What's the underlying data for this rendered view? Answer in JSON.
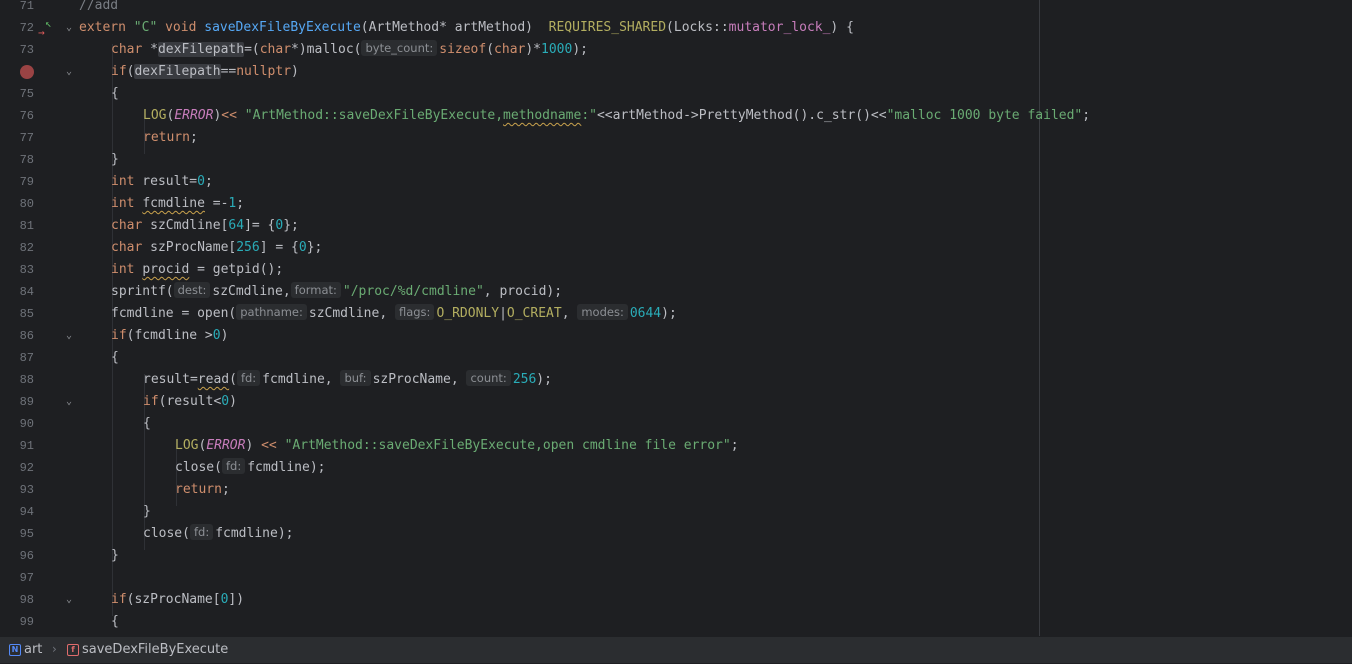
{
  "editor": {
    "line_numbers": [
      "71",
      "72",
      "73",
      "74",
      "75",
      "76",
      "77",
      "78",
      "79",
      "80",
      "81",
      "82",
      "83",
      "84",
      "85",
      "86",
      "87",
      "88",
      "89",
      "90",
      "91",
      "92",
      "93",
      "94",
      "95",
      "96",
      "97",
      "98",
      "99"
    ],
    "l71": {
      "c": "//add"
    },
    "l72": {
      "kw1": "extern",
      "str1": "\"C\"",
      "kw2": "void",
      "fn": "saveDexFileByExecute",
      "p1": "(ArtMethod* artMethod)  ",
      "mac": "REQUIRES_SHARED",
      "p2": "(Locks::",
      "tpl": "mutator_lock_",
      "p3": ") {"
    },
    "l73": {
      "kw1": "char",
      "a": " *",
      "id": "dexFilepath",
      "b": "=(",
      "kw2": "char",
      "c": "*)malloc(",
      "hint": "byte_count:",
      "kw3": "sizeof",
      "d": "(",
      "kw4": "char",
      "e": ")*",
      "num": "1000",
      "f": ");"
    },
    "l74": {
      "kw": "if",
      "a": "(",
      "id": "dexFilepath",
      "b": "==",
      "kw2": "nullptr",
      "c": ")"
    },
    "l75": {
      "a": "{"
    },
    "l76": {
      "mac": "LOG",
      "a": "(",
      "enm": "ERROR",
      "b": ")",
      "op": "<<",
      "s1": " \"ArtMethod::saveDexFileByExecute,",
      "s2": "methodname",
      "s3": ":\"",
      "c": "<<artMethod->PrettyMethod().c_str()<<",
      "s4": "\"malloc 1000 byte failed\"",
      "d": ";"
    },
    "l77": {
      "kw": "return",
      "a": ";"
    },
    "l78": {
      "a": "}"
    },
    "l79": {
      "kw": "int",
      "a": " result=",
      "num": "0",
      "b": ";"
    },
    "l80": {
      "kw": "int",
      "id": "fcmdline",
      "a": " =-",
      "num": "1",
      "b": ";"
    },
    "l81": {
      "kw": "char",
      "a": " szCmdline[",
      "num": "64",
      "b": "]= {",
      "num2": "0",
      "c": "};"
    },
    "l82": {
      "kw": "char",
      "a": " szProcName[",
      "num": "256",
      "b": "] = {",
      "num2": "0",
      "c": "};"
    },
    "l83": {
      "kw": "int",
      "id": "procid",
      "a": " = getpid();"
    },
    "l84": {
      "a": "sprintf(",
      "h1": "dest:",
      "b": "szCmdline,",
      "h2": "format:",
      "s": "\"/proc/%d/cmdline\"",
      "c": ", procid);"
    },
    "l85": {
      "a": "fcmdline = open(",
      "h1": "pathname:",
      "b": "szCmdline, ",
      "h2": "flags:",
      "m1": "O_RDONLY",
      "op": "|",
      "m2": "O_CREAT",
      "c": ", ",
      "h3": "modes:",
      "num": "0644",
      "d": ");"
    },
    "l86": {
      "kw": "if",
      "a": "(fcmdline >",
      "num": "0",
      "b": ")"
    },
    "l87": {
      "a": "{"
    },
    "l88": {
      "a": "result=",
      "id": "read",
      "b": "(",
      "h1": "fd:",
      "c": "fcmdline, ",
      "h2": "buf:",
      "d": "szProcName, ",
      "h3": "count:",
      "num": "256",
      "e": ");"
    },
    "l89": {
      "kw": "if",
      "a": "(result<",
      "num": "0",
      "b": ")"
    },
    "l90": {
      "a": "{"
    },
    "l91": {
      "mac": "LOG",
      "a": "(",
      "enm": "ERROR",
      "b": ") ",
      "op": "<<",
      "s": " \"ArtMethod::saveDexFileByExecute,open cmdline file error\"",
      "c": ";"
    },
    "l92": {
      "a": "close(",
      "h": "fd:",
      "b": "fcmdline);"
    },
    "l93": {
      "kw": "return",
      "a": ";"
    },
    "l94": {
      "a": "}"
    },
    "l95": {
      "a": "close(",
      "h": "fd:",
      "b": "fcmdline);"
    },
    "l96": {
      "a": "}"
    },
    "l98": {
      "kw": "if",
      "a": "(szProcName[",
      "num": "0",
      "b": "])"
    },
    "l99": {
      "a": "{"
    }
  },
  "status_bar": {
    "namespace_icon": "N",
    "namespace": "art",
    "separator": "›",
    "function_icon": "f",
    "function": "saveDexFileByExecute"
  },
  "gutter": {
    "fold_icon": "⌄",
    "impl_up_icon": "↖",
    "impl_down_icon": "→"
  }
}
